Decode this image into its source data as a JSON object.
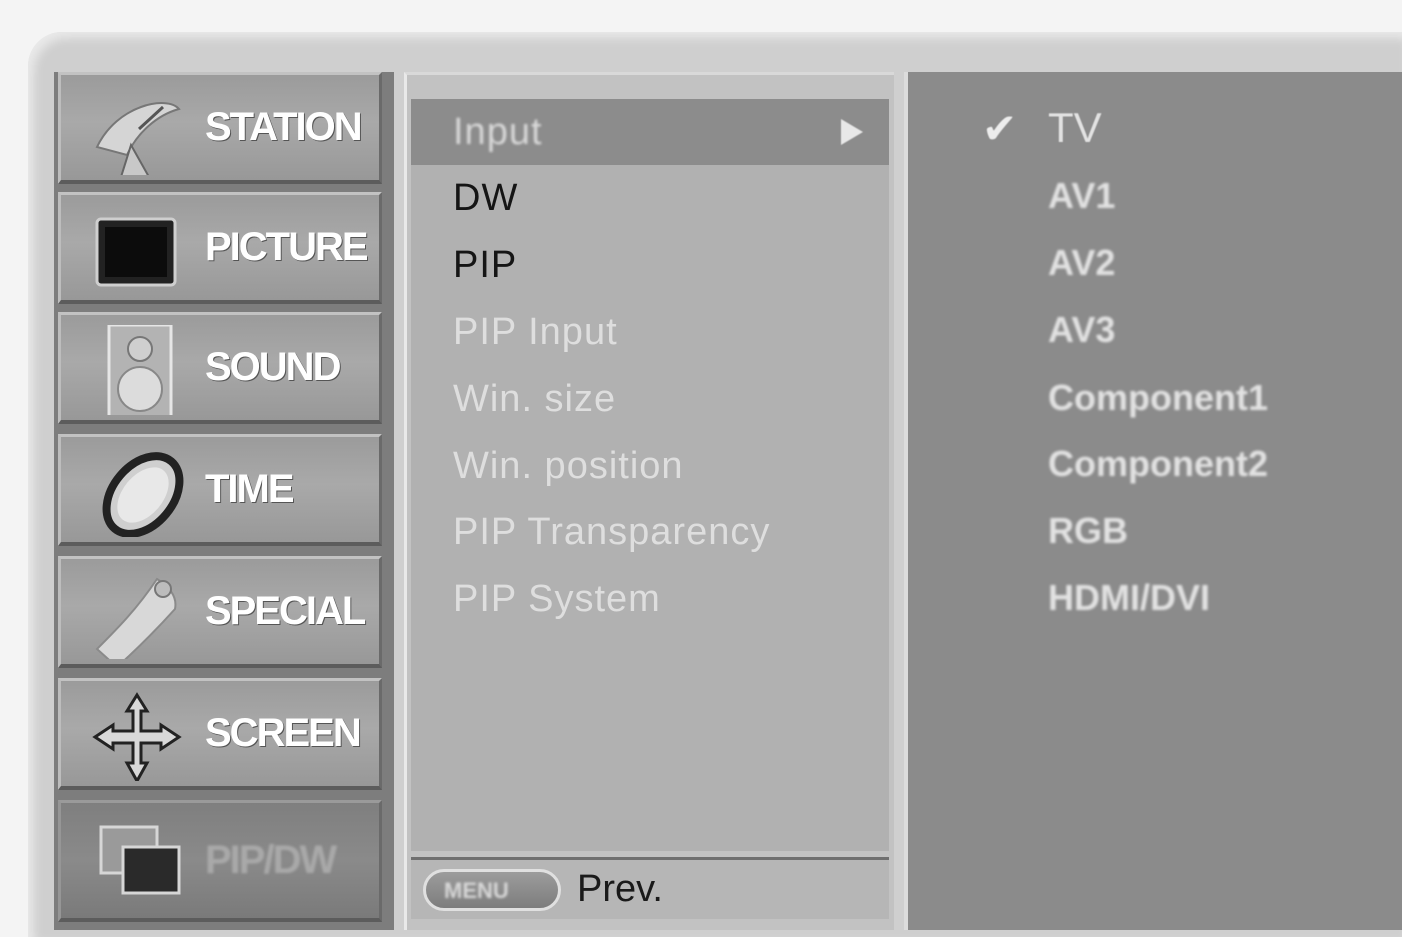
{
  "sidebar": {
    "items": [
      {
        "label": "STATION",
        "icon": "satellite-dish-icon",
        "active": false
      },
      {
        "label": "PICTURE",
        "icon": "tv-screen-icon",
        "active": false
      },
      {
        "label": "SOUND",
        "icon": "speaker-icon",
        "active": false
      },
      {
        "label": "TIME",
        "icon": "clock-icon",
        "active": false
      },
      {
        "label": "SPECIAL",
        "icon": "remote-hand-icon",
        "active": false
      },
      {
        "label": "SCREEN",
        "icon": "move-arrows-icon",
        "active": false
      },
      {
        "label": "PIP/DW",
        "icon": "pip-windows-icon",
        "active": true
      }
    ]
  },
  "menu": {
    "items": [
      {
        "label": "Input",
        "state": "selected"
      },
      {
        "label": "DW",
        "state": "enabled"
      },
      {
        "label": "PIP",
        "state": "enabled"
      },
      {
        "label": "PIP Input",
        "state": "disabled"
      },
      {
        "label": "Win. size",
        "state": "disabled"
      },
      {
        "label": "Win. position",
        "state": "disabled"
      },
      {
        "label": "PIP Transparency",
        "state": "disabled"
      },
      {
        "label": "PIP System",
        "state": "disabled"
      }
    ],
    "footer": {
      "button_label": "MENU",
      "text": "Prev."
    }
  },
  "options": {
    "checkmark": "✔",
    "items": [
      {
        "label": "TV",
        "checked": true
      },
      {
        "label": "AV1",
        "checked": false
      },
      {
        "label": "AV2",
        "checked": false
      },
      {
        "label": "AV3",
        "checked": false
      },
      {
        "label": "Component1",
        "checked": false
      },
      {
        "label": "Component2",
        "checked": false
      },
      {
        "label": "RGB",
        "checked": false
      },
      {
        "label": "HDMI/DVI",
        "checked": false
      }
    ]
  }
}
